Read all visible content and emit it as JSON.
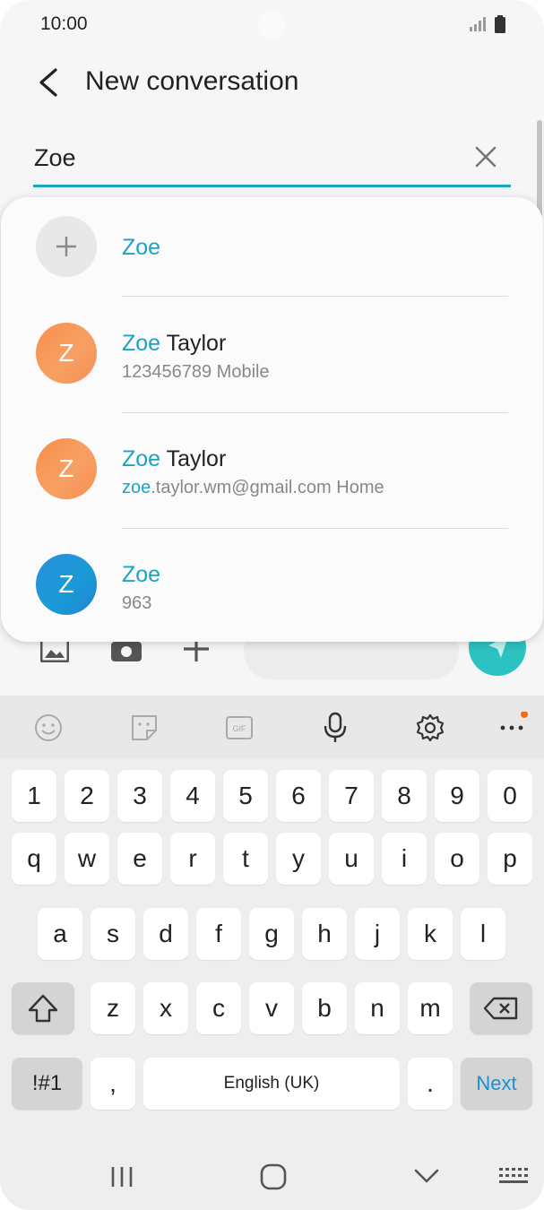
{
  "status": {
    "time": "10:00"
  },
  "header": {
    "title": "New conversation"
  },
  "search": {
    "value": "Zoe"
  },
  "suggestions": {
    "add_label": "Zoe",
    "items": [
      {
        "avatar_letter": "Z",
        "name_match": "Zoe",
        "name_rest": " Taylor",
        "detail_match": "",
        "detail_rest": "123456789  Mobile"
      },
      {
        "avatar_letter": "Z",
        "name_match": "Zoe",
        "name_rest": " Taylor",
        "detail_match": "zoe",
        "detail_rest": ".taylor.wm@gmail.com  Home"
      },
      {
        "avatar_letter": "Z",
        "name_match": "Zoe",
        "name_rest": "",
        "detail_match": "",
        "detail_rest": "963"
      }
    ]
  },
  "keyboard": {
    "row_numbers": [
      "1",
      "2",
      "3",
      "4",
      "5",
      "6",
      "7",
      "8",
      "9",
      "0"
    ],
    "row1": [
      "q",
      "w",
      "e",
      "r",
      "t",
      "y",
      "u",
      "i",
      "o",
      "p"
    ],
    "row2": [
      "a",
      "s",
      "d",
      "f",
      "g",
      "h",
      "j",
      "k",
      "l"
    ],
    "row3": [
      "z",
      "x",
      "c",
      "v",
      "b",
      "n",
      "m"
    ],
    "symbols_label": "!#1",
    "comma_label": ",",
    "space_label": "English (UK)",
    "period_label": ".",
    "action_label": "Next"
  },
  "colors": {
    "accent": "#1ba3c6",
    "send": "#2cc2c1",
    "notify_dot": "#f26b1d"
  }
}
